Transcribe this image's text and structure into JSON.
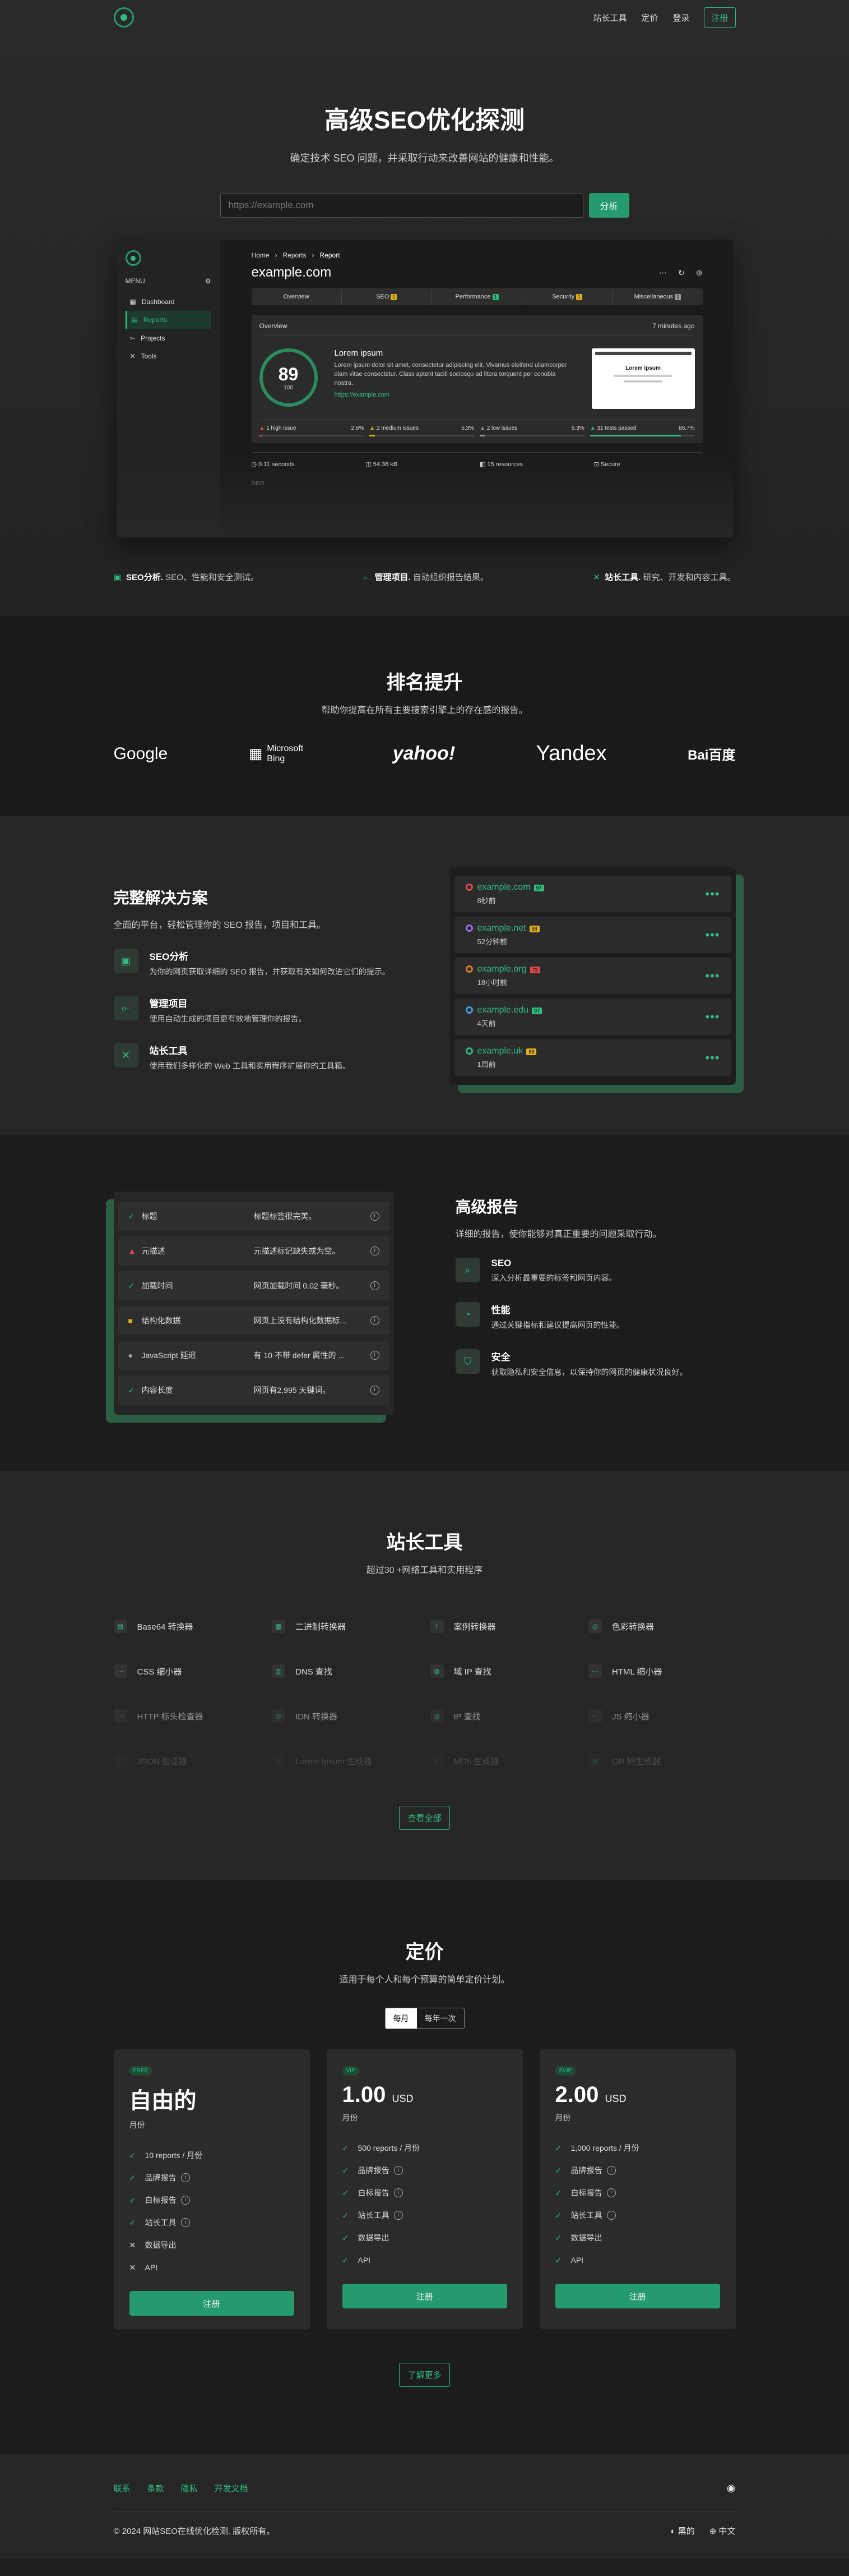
{
  "header": {
    "nav": [
      "站长工具",
      "定价",
      "登录"
    ],
    "register": "注册"
  },
  "hero": {
    "title": "高级SEO优化探测",
    "subtitle": "确定技术 SEO 问题，并采取行动来改善网站的健康和性能。",
    "placeholder": "https://example.com",
    "analyze": "分析"
  },
  "app": {
    "menu": "MENU",
    "sidebar": [
      "Dashboard",
      "Reports",
      "Projects",
      "Tools"
    ],
    "crumbs": [
      "Home",
      "Reports",
      "Report"
    ],
    "domain": "example.com",
    "tabs": [
      "Overview",
      "SEO",
      "Performance",
      "Security",
      "Miscellaneous"
    ],
    "tab_badges": [
      "",
      "1",
      "1",
      "1",
      "1"
    ],
    "overview": "Overview",
    "ago": "7 minutes ago",
    "score": "89",
    "score_label": "100",
    "site_title": "Lorem ipsum",
    "site_desc": "Lorem ipsum dolor sit amet, consectetur adipiscing elit. Vivamus eleifend ullamcorper diam vitae consectetur. Class aptent taciti sociosqu ad litora torquent per conubia nostra.",
    "site_url": "https://example.com",
    "thumb_title": "Lorem ipsum",
    "issues": [
      {
        "label": "1 high issue",
        "pct": "2.6%",
        "color": "#e04b4b",
        "fill": 0.03
      },
      {
        "label": "2 medium issues",
        "pct": "5.3%",
        "color": "#e0b020",
        "fill": 0.05
      },
      {
        "label": "2 low issues",
        "pct": "5.3%",
        "color": "#999999",
        "fill": 0.05
      },
      {
        "label": "31 tests passed",
        "pct": "86.7%",
        "color": "#2fbd80",
        "fill": 0.87
      }
    ],
    "metrics": [
      "0.11 seconds",
      "54.36 kB",
      "15 resources",
      "Secure"
    ],
    "seo_tail": "SEO"
  },
  "features": [
    {
      "b": "SEO分析.",
      "t": " SEO、性能和安全测试。"
    },
    {
      "b": "管理项目.",
      "t": " 自动组织报告结果。"
    },
    {
      "b": "站长工具.",
      "t": " 研究、开发和内容工具。"
    }
  ],
  "rank": {
    "title": "排名提升",
    "subtitle": "帮助你提高在所有主要搜索引擎上的存在感的报告。",
    "logos": [
      "Google",
      "Microsoft Bing",
      "yahoo!",
      "Yandex",
      "Bai百度"
    ]
  },
  "complete": {
    "title": "完整解决方案",
    "subtitle": "全面的平台，轻松管理你的 SEO 报告，项目和工具。",
    "items": [
      {
        "title": "SEO分析",
        "desc": "为你的网页获取详细的 SEO 报告，并获取有关如何改进它们的提示。"
      },
      {
        "title": "管理项目",
        "desc": "使用自动生成的项目更有效地管理你的报告。"
      },
      {
        "title": "站长工具",
        "desc": "使用我们多样化的 Web 工具和实用程序扩展你的工具箱。"
      }
    ],
    "sites": [
      {
        "name": "example.com",
        "tag": "97",
        "tagc": "#2fbd80",
        "time": "8秒前",
        "ic": "#e04b4b"
      },
      {
        "name": "example.net",
        "tag": "88",
        "tagc": "#e0b020",
        "time": "52分钟前",
        "ic": "#9b6fe0"
      },
      {
        "name": "example.org",
        "tag": "73",
        "tagc": "#e04b4b",
        "time": "18小时前",
        "ic": "#e07a2b"
      },
      {
        "name": "example.edu",
        "tag": "97",
        "tagc": "#2fbd80",
        "time": "4天前",
        "ic": "#3fa0e0"
      },
      {
        "name": "example.uk",
        "tag": "88",
        "tagc": "#e0b020",
        "time": "1周前",
        "ic": "#2fbd80"
      }
    ]
  },
  "reports": {
    "title": "高级报告",
    "subtitle": "详细的报告，使你能够对真正重要的问题采取行动。",
    "rows": [
      {
        "k": "标题",
        "v": "标题标签很完美。",
        "icon": "✓",
        "c": "#2fbd80"
      },
      {
        "k": "元描述",
        "v": "元描述标记缺失或为空。",
        "icon": "▲",
        "c": "#e04b4b"
      },
      {
        "k": "加载时间",
        "v": "网页加载时间 0.02 毫秒。",
        "icon": "✓",
        "c": "#2fbd80"
      },
      {
        "k": "结构化数据",
        "v": "网页上没有结构化数据标...",
        "icon": "■",
        "c": "#e0b020"
      },
      {
        "k": "JavaScript 延迟",
        "v": "有 10 不带 defer 属性的 ...",
        "icon": "●",
        "c": "#aaaaaa"
      },
      {
        "k": "内容长度",
        "v": "网页有2,995 天键词。",
        "icon": "✓",
        "c": "#2fbd80"
      }
    ],
    "items": [
      {
        "title": "SEO",
        "desc": "深入分析最重要的标签和网页内容。"
      },
      {
        "title": "性能",
        "desc": "通过关键指标和建议提高网页的性能。"
      },
      {
        "title": "安全",
        "desc": "获取隐私和安全信息，以保持你的网页的健康状况良好。"
      }
    ]
  },
  "tools": {
    "title": "站长工具",
    "subtitle": "超过30 +网络工具和实用程序",
    "items": [
      "Base64 转换器",
      "二进制转换器",
      "案例转换器",
      "色彩转换器",
      "CSS 缩小器",
      "DNS 查找",
      "域 IP 查找",
      "HTML 缩小器",
      "HTTP 标头检查器",
      "IDN 转换器",
      "IP 查找",
      "JS 缩小器",
      "JSON 验证器",
      "Lorem Ipsum 生成器",
      "MD5 生成器",
      "QR 码生成器"
    ],
    "more": "查看全部"
  },
  "pricing": {
    "title": "定价",
    "subtitle": "适用于每个人和每个预算的简单定价计划。",
    "toggle": [
      "每月",
      "每年一次"
    ],
    "plans": [
      {
        "pill": "FREE",
        "price": "自由的",
        "unit": "",
        "per": "月份",
        "feats": [
          [
            "10 reports / 月份",
            1,
            0
          ],
          [
            "品牌报告",
            1,
            1
          ],
          [
            "白标报告",
            1,
            1
          ],
          [
            "站长工具",
            1,
            1
          ],
          [
            "数据导出",
            0,
            0
          ],
          [
            "API",
            0,
            0
          ]
        ]
      },
      {
        "pill": "VIP",
        "price": "1.00",
        "unit": "USD",
        "per": "月份",
        "feats": [
          [
            "500 reports / 月份",
            1,
            0
          ],
          [
            "品牌报告",
            1,
            1
          ],
          [
            "白标报告",
            1,
            1
          ],
          [
            "站长工具",
            1,
            1
          ],
          [
            "数据导出",
            1,
            0
          ],
          [
            "API",
            1,
            0
          ]
        ]
      },
      {
        "pill": "SVIP",
        "price": "2.00",
        "unit": "USD",
        "per": "月份",
        "feats": [
          [
            "1,000 reports / 月份",
            1,
            0
          ],
          [
            "品牌报告",
            1,
            1
          ],
          [
            "白标报告",
            1,
            1
          ],
          [
            "站长工具",
            1,
            1
          ],
          [
            "数据导出",
            1,
            0
          ],
          [
            "API",
            1,
            0
          ]
        ]
      }
    ],
    "register": "注册",
    "learn": "了解更多"
  },
  "footer": {
    "links": [
      "联系",
      "条款",
      "隐私",
      "开发文档"
    ],
    "copy": "© 2024 网站SEO在线优化检测. 版权所有。",
    "theme": "黑的",
    "lang": "中文"
  }
}
